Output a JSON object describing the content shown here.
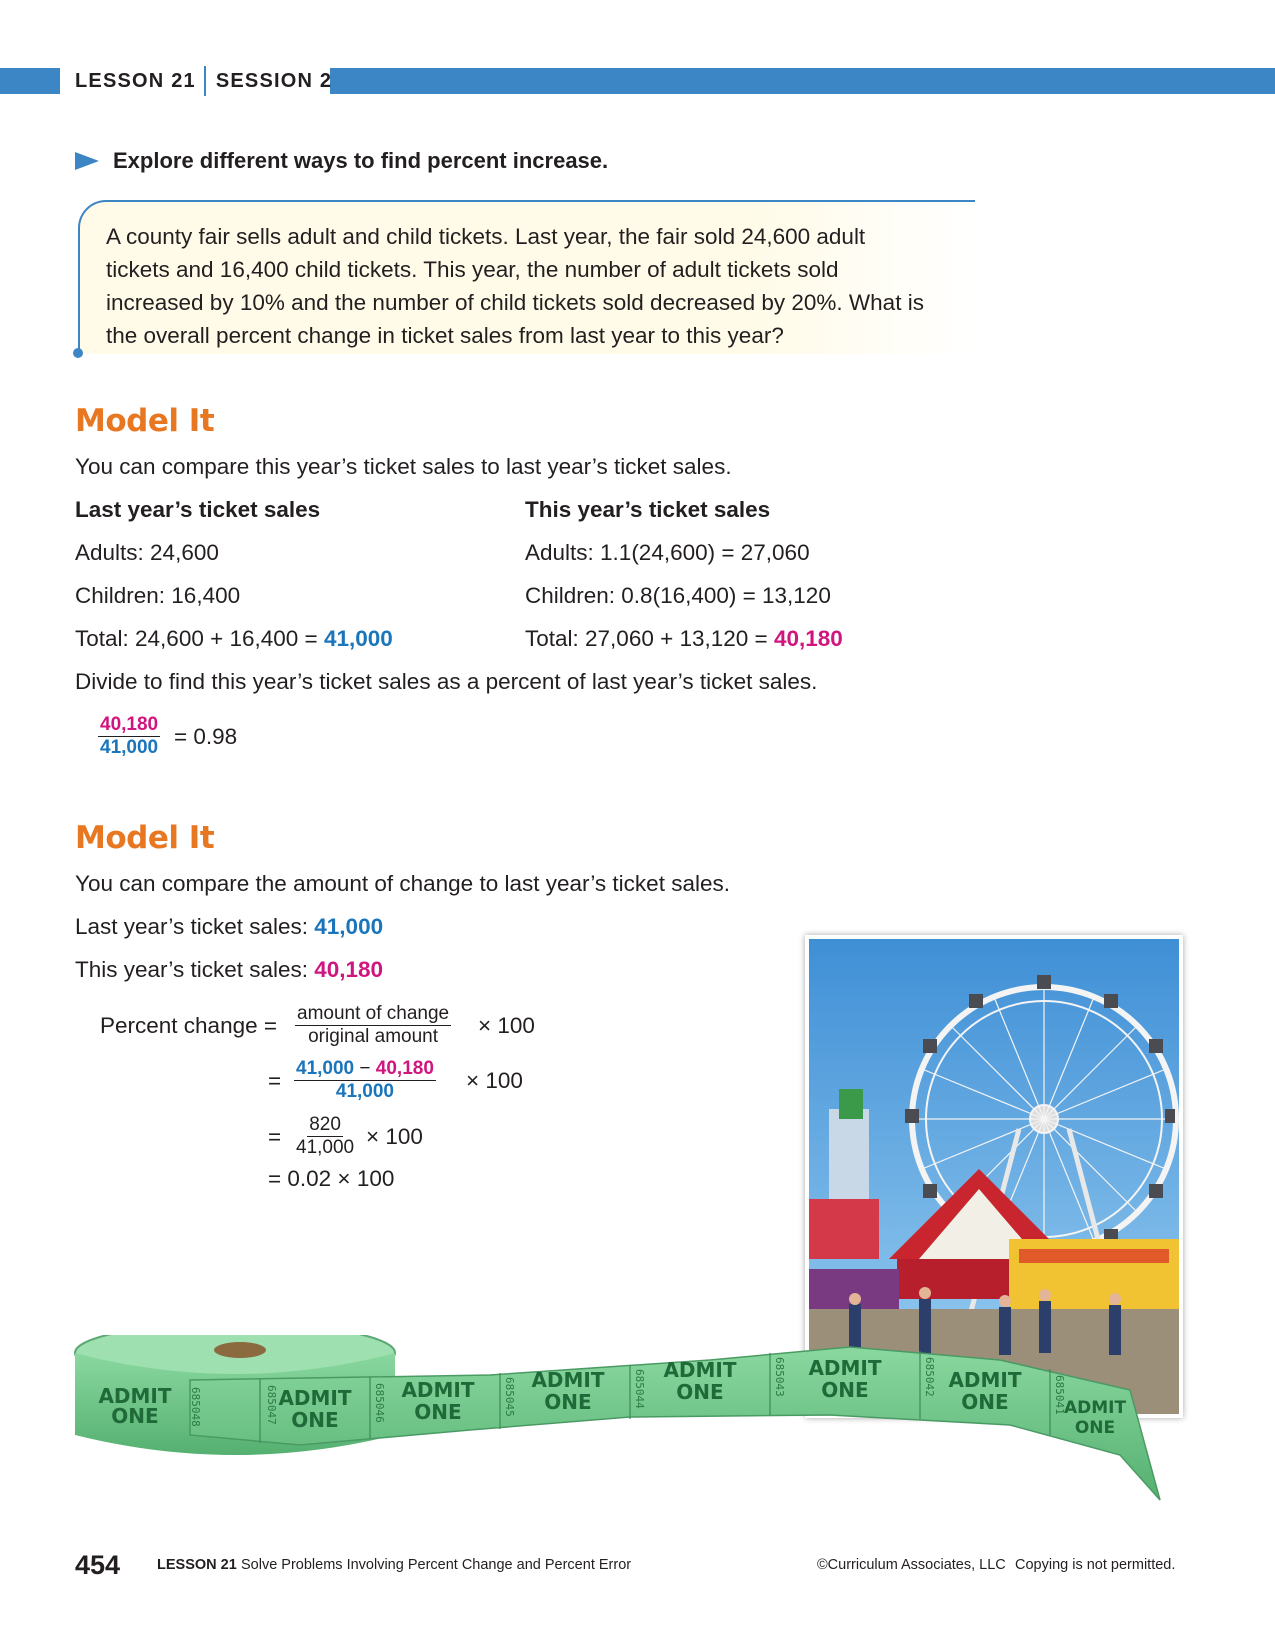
{
  "header": {
    "lesson": "LESSON 21",
    "session": "SESSION 2"
  },
  "explore": "Explore different ways to find percent increase.",
  "problem": {
    "lines": [
      "A county fair sells adult and child tickets. Last year, the fair sold 24,600 adult",
      "tickets and 16,400 child tickets. This year, the number of adult tickets sold",
      "increased by 10% and the number of child tickets sold decreased by 20%. What is",
      "the overall percent change in ticket sales from last year to this year?"
    ]
  },
  "model1": {
    "title": "Model It",
    "intro": "You can compare this year’s ticket sales to last year’s ticket sales.",
    "last_heading": "Last year’s ticket sales",
    "this_heading": "This year’s ticket sales",
    "last_adults": "Adults: 24,600",
    "last_children": "Children: 16,400",
    "last_total_prefix": "Total: 24,600 + 16,400 = ",
    "last_total": "41,000",
    "this_adults": "Adults: 1.1(24,600) = 27,060",
    "this_children": "Children: 0.8(16,400) = 13,120",
    "this_total_prefix": "Total: 27,060 + 13,120 = ",
    "this_total": "40,180",
    "divide": "Divide to find this year’s ticket sales as a percent of last year’s ticket sales.",
    "frac_num": "40,180",
    "frac_den": "41,000",
    "frac_result": "= 0.98"
  },
  "model2": {
    "title": "Model It",
    "intro": "You can compare the amount of change to last year’s ticket sales.",
    "last_label": "Last year’s ticket sales: ",
    "last_value": "41,000",
    "this_label": "This year’s ticket sales: ",
    "this_value": "40,180",
    "pc_label": "Percent change =",
    "f1_num": "amount of change",
    "f1_den": "original amount",
    "times100": "× 100",
    "eq": "=",
    "f2_num_a": "41,000",
    "f2_minus": " − ",
    "f2_num_b": "40,180",
    "f2_den": "41,000",
    "f3_num": "820",
    "f3_den": "41,000",
    "last_step": "= 0.02 × 100"
  },
  "tickets": {
    "stub_text": [
      "ADMIT",
      "ONE"
    ],
    "serials": [
      "685048",
      "685047",
      "685046",
      "685045",
      "685044",
      "685043",
      "685042",
      "685041"
    ]
  },
  "footer": {
    "page": "454",
    "lesson": "LESSON 21",
    "title": "Solve Problems Involving Percent Change and Percent Error",
    "copyright": "©Curriculum Associates, LLC",
    "notice": "Copying is not permitted."
  },
  "colors": {
    "accent_blue": "#3d86c6",
    "model_orange": "#e87722",
    "value_blue": "#1a75bb",
    "value_magenta": "#d0157f",
    "ticket_green": "#6fc88a"
  }
}
